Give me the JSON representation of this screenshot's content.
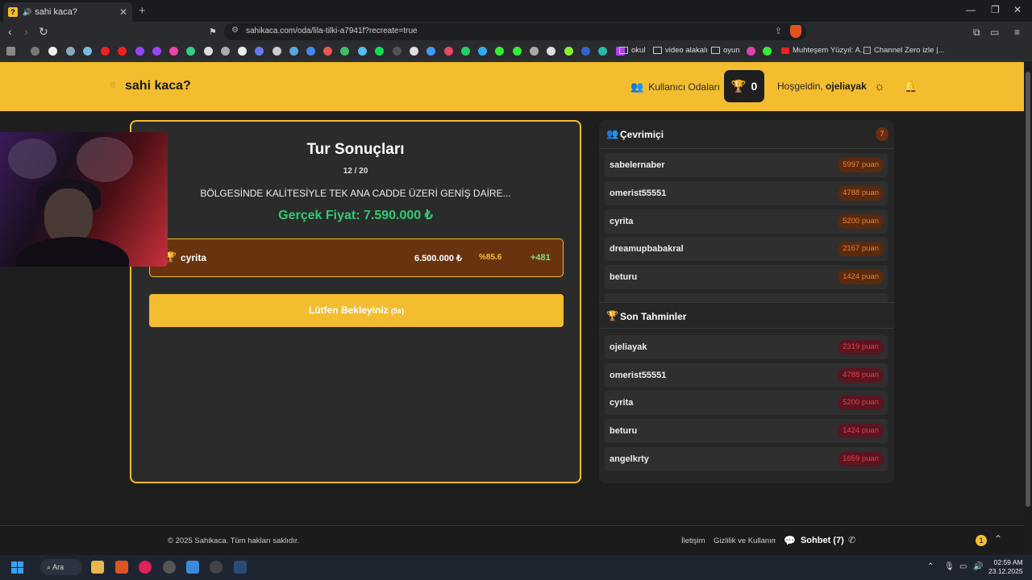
{
  "browser": {
    "tab_title": "sahi kaca?",
    "tab_favicon": "?",
    "url": "sahikaca.com/oda/lila-tilki-a7941f?recreate=true",
    "bookmarks": {
      "okul": "okul",
      "video": "video alakalı",
      "oyun": "oyun",
      "muhtesem": "Muhteşem Yüzyıl: A...",
      "channel": "Channel Zero izle |..."
    }
  },
  "header": {
    "logo": "sahi kaca?",
    "rooms_link": "Kullanıcı Odaları",
    "trophy_count": "0",
    "welcome_prefix": "Hoşgeldin,",
    "username": "ojeliayak"
  },
  "round": {
    "title": "Tur Sonuçları",
    "progress": "12 / 20",
    "description": "BÖLGESİNDE KALİTESİYLE TEK ANA CADDE ÜZERİ GENİŞ DAİRE...",
    "real_price": "Gerçek Fiyat: 7.590.000 ₺",
    "result": {
      "name": "cyrita",
      "guess": "6.500.000 ₺",
      "accuracy": "%85.6",
      "points": "+481"
    },
    "wait_label": "Lütfen Bekleyiniz",
    "wait_seconds": "(5s)"
  },
  "online": {
    "title": "Çevrimiçi",
    "count": "7",
    "players": [
      {
        "name": "sabelernaber",
        "points": "5997 puan"
      },
      {
        "name": "omerist55551",
        "points": "4788 puan"
      },
      {
        "name": "cyrita",
        "points": "5200 puan"
      },
      {
        "name": "dreamupbabakral",
        "points": "2167 puan"
      },
      {
        "name": "beturu",
        "points": "1424 puan"
      }
    ]
  },
  "recent": {
    "title": "Son Tahminler",
    "players": [
      {
        "name": "ojeliayak",
        "points": "2319 puan"
      },
      {
        "name": "omerist55551",
        "points": "4788 puan"
      },
      {
        "name": "cyrita",
        "points": "5200 puan"
      },
      {
        "name": "beturu",
        "points": "1424 puan"
      },
      {
        "name": "angelkrty",
        "points": "1659 puan"
      }
    ]
  },
  "footer": {
    "copyright": "© 2025 Sahikaca. Tüm hakları saklıdır.",
    "contact": "İletişim",
    "privacy": "Gizlilik ve Kullanım",
    "chat_label": "Sohbet (7)",
    "notif_count": "1"
  },
  "taskbar": {
    "search": "Ara",
    "time": "02:59 AM",
    "date": "23.12.2025"
  },
  "colors": {
    "accent": "#f3bd2f",
    "success": "#2ecc71",
    "panel": "#2b2b2b"
  }
}
